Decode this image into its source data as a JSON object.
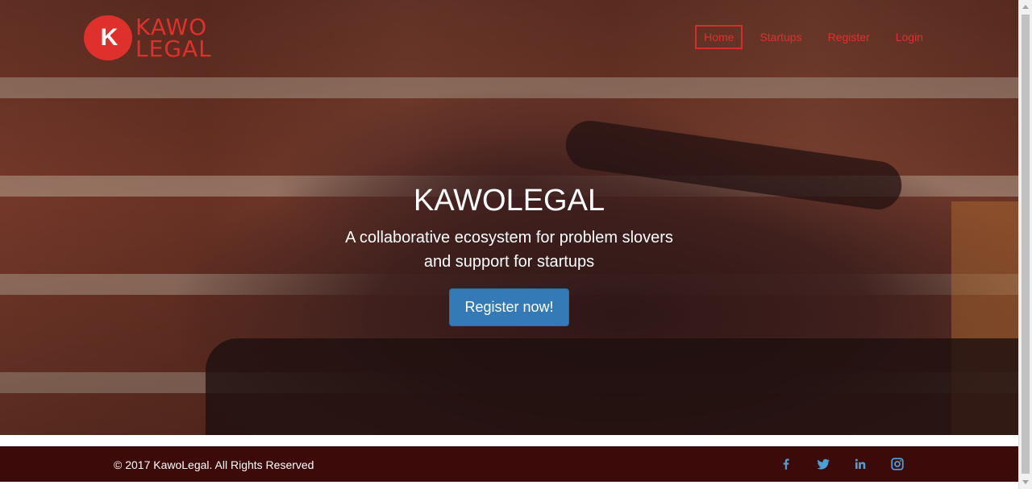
{
  "brand": {
    "logo_mark": "K",
    "logo_line1": "KAWO",
    "logo_line2": "LEGAL",
    "accent_color": "#e0302c"
  },
  "nav": {
    "items": [
      {
        "label": "Home",
        "active": true
      },
      {
        "label": "Startups",
        "active": false
      },
      {
        "label": "Register",
        "active": false
      },
      {
        "label": "Login",
        "active": false
      }
    ]
  },
  "hero": {
    "title": "KAWOLEGAL",
    "subtitle_line1": "A collaborative ecosystem for problem slovers",
    "subtitle_line2": "and support for startups",
    "cta_label": "Register now!",
    "cta_color": "#337ab7"
  },
  "footer": {
    "copyright": "© 2017 KawoLegal. All Rights Reserved",
    "background_color": "#3d0a0a",
    "social_icons": [
      "facebook-icon",
      "twitter-icon",
      "linkedin-icon",
      "instagram-icon"
    ],
    "social_color": "#4a9fd5"
  }
}
